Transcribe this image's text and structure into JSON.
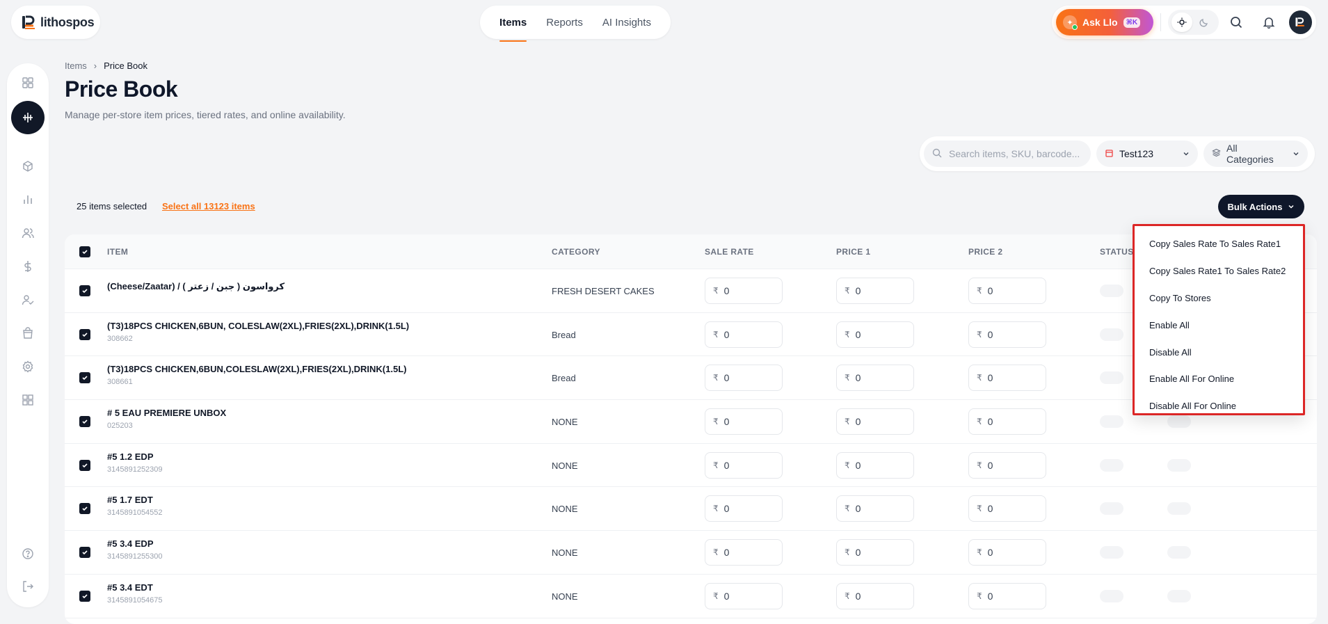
{
  "app": {
    "name": "lithospos"
  },
  "topnav": {
    "tabs": [
      "Items",
      "Reports",
      "AI Insights"
    ],
    "active": "Items"
  },
  "header_right": {
    "ask_label": "Ask Llo",
    "ask_shortcut": "⌘K"
  },
  "breadcrumb": {
    "parent": "Items",
    "current": "Price Book"
  },
  "page": {
    "title": "Price Book",
    "subtitle": "Manage per-store item prices, tiered rates, and online availability."
  },
  "filters": {
    "search_placeholder": "Search items, SKU, barcode...",
    "store": "Test123",
    "category": "All Categories"
  },
  "selection": {
    "info": "25 items selected",
    "select_all": "Select all 13123 items"
  },
  "bulk": {
    "label": "Bulk Actions",
    "menu": [
      "Copy Sales Rate To Sales Rate1",
      "Copy Sales Rate1 To Sales Rate2",
      "Copy To Stores",
      "Enable All",
      "Disable All",
      "Enable All For Online",
      "Disable All For Online"
    ]
  },
  "table": {
    "columns": [
      "ITEM",
      "CATEGORY",
      "SALE RATE",
      "PRICE 1",
      "PRICE 2",
      "STATUS"
    ],
    "currency": "₹",
    "rows": [
      {
        "name": "(Cheese/Zaatar) / ( جبن / زعتر ) كرواسون",
        "sku": "",
        "category": "FRESH DESERT CAKES",
        "sale": "0",
        "p1": "0",
        "p2": "0"
      },
      {
        "name": "(T3)18PCS CHICKEN,6BUN, COLESLAW(2XL),FRIES(2XL),DRINK(1.5L)",
        "sku": "308662",
        "category": "Bread",
        "sale": "0",
        "p1": "0",
        "p2": "0"
      },
      {
        "name": "(T3)18PCS CHICKEN,6BUN,COLESLAW(2XL),FRIES(2XL),DRINK(1.5L)",
        "sku": "308661",
        "category": "Bread",
        "sale": "0",
        "p1": "0",
        "p2": "0"
      },
      {
        "name": "# 5 EAU PREMIERE UNBOX",
        "sku": "025203",
        "category": "NONE",
        "sale": "0",
        "p1": "0",
        "p2": "0"
      },
      {
        "name": "#5 1.2 EDP",
        "sku": "3145891252309",
        "category": "NONE",
        "sale": "0",
        "p1": "0",
        "p2": "0"
      },
      {
        "name": "#5 1.7 EDT",
        "sku": "3145891054552",
        "category": "NONE",
        "sale": "0",
        "p1": "0",
        "p2": "0"
      },
      {
        "name": "#5 3.4 EDP",
        "sku": "3145891255300",
        "category": "NONE",
        "sale": "0",
        "p1": "0",
        "p2": "0"
      },
      {
        "name": "#5 3.4 EDT",
        "sku": "3145891054675",
        "category": "NONE",
        "sale": "0",
        "p1": "0",
        "p2": "0"
      }
    ]
  },
  "colors": {
    "accent": "#f97316",
    "dark": "#0f172a",
    "highlight_border": "#dc2626"
  }
}
